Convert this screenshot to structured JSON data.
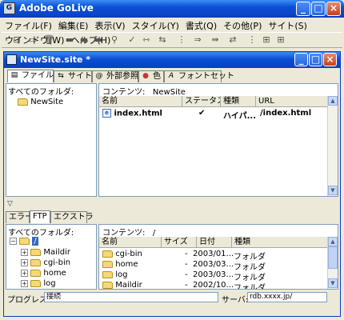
{
  "app": {
    "title": "Adobe GoLive"
  },
  "menu": [
    "ファイル(F)",
    "編集(E)",
    "表示(V)",
    "スタイル(Y)",
    "書式(Q)",
    "その他(P)",
    "サイト(S)",
    "ウインドウ(W)",
    "ヘルプ(H)"
  ],
  "toolbar_icons": [
    "site-icon",
    "new-folder-icon",
    "delete-icon",
    "upload-icon",
    "download-icon",
    "sync-icon",
    "find-icon",
    "check-icon",
    "links-icon",
    "arrows-icon",
    "collapse-icon",
    "connect-icon",
    "disconnect-icon",
    "sync-arrows-icon",
    "tree-icon",
    "view-icon",
    "grid-icon"
  ],
  "site_window": {
    "title": "NewSite.site *",
    "tabs": [
      "ファイル",
      "サイト",
      "外部参照",
      "色",
      "フォントセット"
    ],
    "folders_label": "すべてのフォルダ:",
    "folder_tree": [
      "NewSite"
    ],
    "contents_label": "コンテンツ:",
    "contents_path": "NewSite",
    "columns": [
      "名前",
      "ステータス",
      "種類",
      "URL"
    ],
    "files": [
      {
        "name": "index.html",
        "status": "✔",
        "type": "ハイパ...",
        "url": "/index.html"
      }
    ]
  },
  "ftp_panel": {
    "tabs": [
      "エラー",
      "FTP",
      "エクストラ"
    ],
    "folders_label": "すべてのフォルダ:",
    "root": "/",
    "tree": [
      "Maildir",
      "cgi-bin",
      "home",
      "log"
    ],
    "contents_label": "コンテンツ:",
    "contents_path": "/",
    "columns": [
      "名前",
      "サイズ",
      "日付",
      "種類"
    ],
    "rows": [
      {
        "name": "cgi-bin",
        "size": "-",
        "date": "2003/01...",
        "type": "フォルダ"
      },
      {
        "name": "home",
        "size": "-",
        "date": "2003/03...",
        "type": "フォルダ"
      },
      {
        "name": "log",
        "size": "-",
        "date": "2003/03...",
        "type": "フォルダ"
      },
      {
        "name": "Maildir",
        "size": "-",
        "date": "2002/10...",
        "type": "フォルダ"
      }
    ],
    "progress_label": "プログレス:",
    "progress_value": "接続",
    "server_label": "サーバ:",
    "server_value": "rdb.xxxx.jp/"
  }
}
